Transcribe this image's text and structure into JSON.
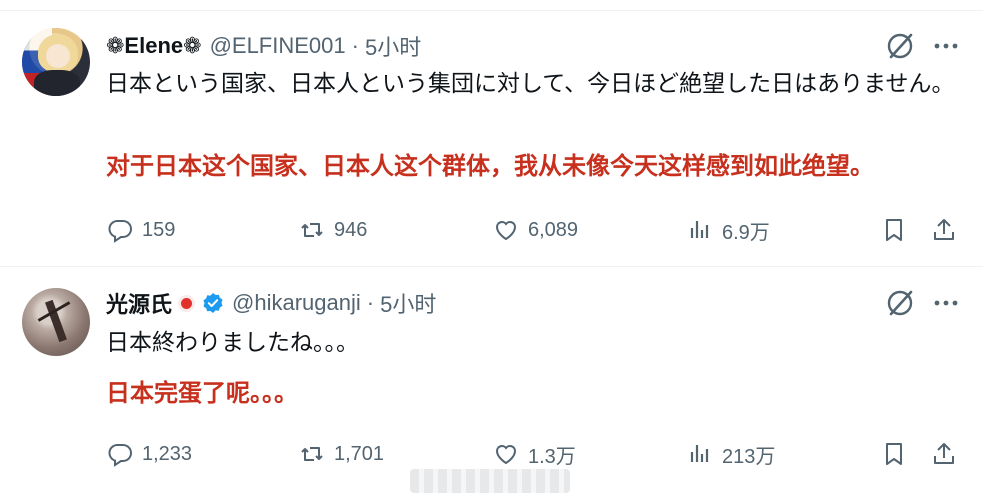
{
  "tweets": [
    {
      "display_name": "❁Elene❁",
      "handle": "@ELFINE001",
      "separator": "·",
      "time": "5小时",
      "text_jp": "日本という国家、日本人という集団に対して、今日ほど絶望した日はありません。",
      "text_cn": "对于日本这个国家、日本人这个群体，我从未像今天这样感到如此绝望。",
      "replies": "159",
      "retweets": "946",
      "likes": "6,089",
      "views": "6.9万"
    },
    {
      "display_name": "光源氏",
      "handle": "@hikaruganji",
      "separator": "·",
      "time": "5小时",
      "text_jp": "日本終わりましたね。。。",
      "text_cn": "日本完蛋了呢。。。",
      "replies": "1,233",
      "retweets": "1,701",
      "likes": "1.3万",
      "views": "213万"
    }
  ],
  "icons": [
    "grok-icon",
    "more-icon",
    "reply-icon",
    "retweet-icon",
    "like-icon",
    "views-icon",
    "bookmark-icon",
    "share-icon",
    "verified-badge-icon"
  ],
  "colors": {
    "text": "#0f1419",
    "muted": "#536471",
    "accent_red": "#c8301e",
    "verified_blue": "#1d9bf0"
  }
}
